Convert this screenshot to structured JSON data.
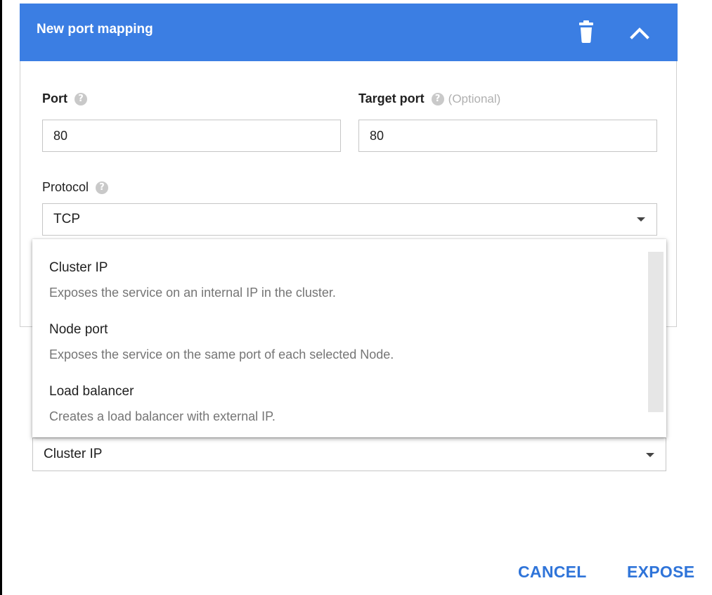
{
  "header": {
    "title": "New port mapping",
    "delete_icon": "trash-icon",
    "collapse_icon": "chevron-up-icon",
    "color": "#3b7ee3"
  },
  "port": {
    "label": "Port",
    "value": "80"
  },
  "target_port": {
    "label": "Target port",
    "optional": "(Optional)",
    "value": "80"
  },
  "protocol": {
    "label": "Protocol",
    "selected": "TCP"
  },
  "service_type": {
    "selected": "Cluster IP",
    "options": [
      {
        "title": "Cluster IP",
        "desc": "Exposes the service on an internal IP in the cluster."
      },
      {
        "title": "Node port",
        "desc": "Exposes the service on the same port of each selected Node."
      },
      {
        "title": "Load balancer",
        "desc": "Creates a load balancer with external IP."
      }
    ]
  },
  "actions": {
    "cancel": "CANCEL",
    "expose": "EXPOSE",
    "color": "#2f74d9"
  }
}
